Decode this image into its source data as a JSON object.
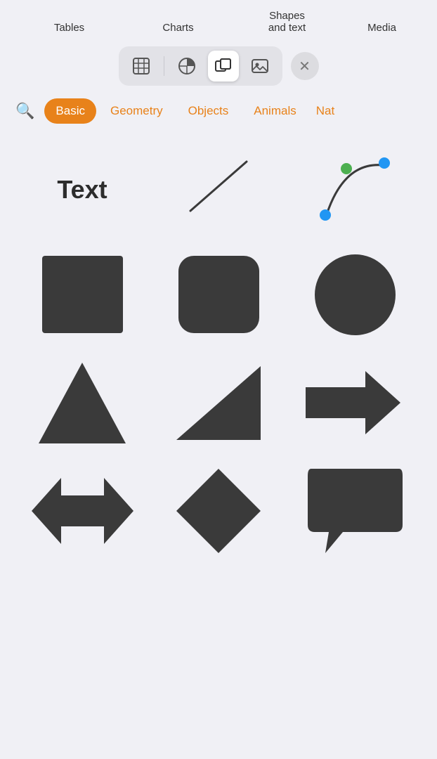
{
  "topLabels": {
    "tables": "Tables",
    "charts": "Charts",
    "shapesAndText": "Shapes\nand text",
    "media": "Media"
  },
  "toolbar": {
    "buttons": [
      {
        "id": "tables",
        "icon": "table",
        "active": false
      },
      {
        "id": "charts",
        "icon": "chart",
        "active": false
      },
      {
        "id": "shapes",
        "icon": "shapes",
        "active": true
      },
      {
        "id": "media",
        "icon": "media",
        "active": false
      }
    ],
    "closeLabel": "×"
  },
  "categories": {
    "search": "🔍",
    "tabs": [
      {
        "id": "basic",
        "label": "Basic",
        "active": true
      },
      {
        "id": "geometry",
        "label": "Geometry",
        "active": false
      },
      {
        "id": "objects",
        "label": "Objects",
        "active": false
      },
      {
        "id": "animals",
        "label": "Animals",
        "active": false
      },
      {
        "id": "nature",
        "label": "Nat...",
        "active": false
      }
    ]
  },
  "shapes": {
    "row1": [
      {
        "id": "text",
        "label": "Text"
      },
      {
        "id": "line",
        "label": ""
      },
      {
        "id": "curve",
        "label": ""
      }
    ]
  },
  "colors": {
    "accent": "#e8821a",
    "shapeColor": "#3a3a3a",
    "curveGreen": "#4caf50",
    "curveBlue": "#2196f3",
    "background": "#f0f0f5"
  }
}
